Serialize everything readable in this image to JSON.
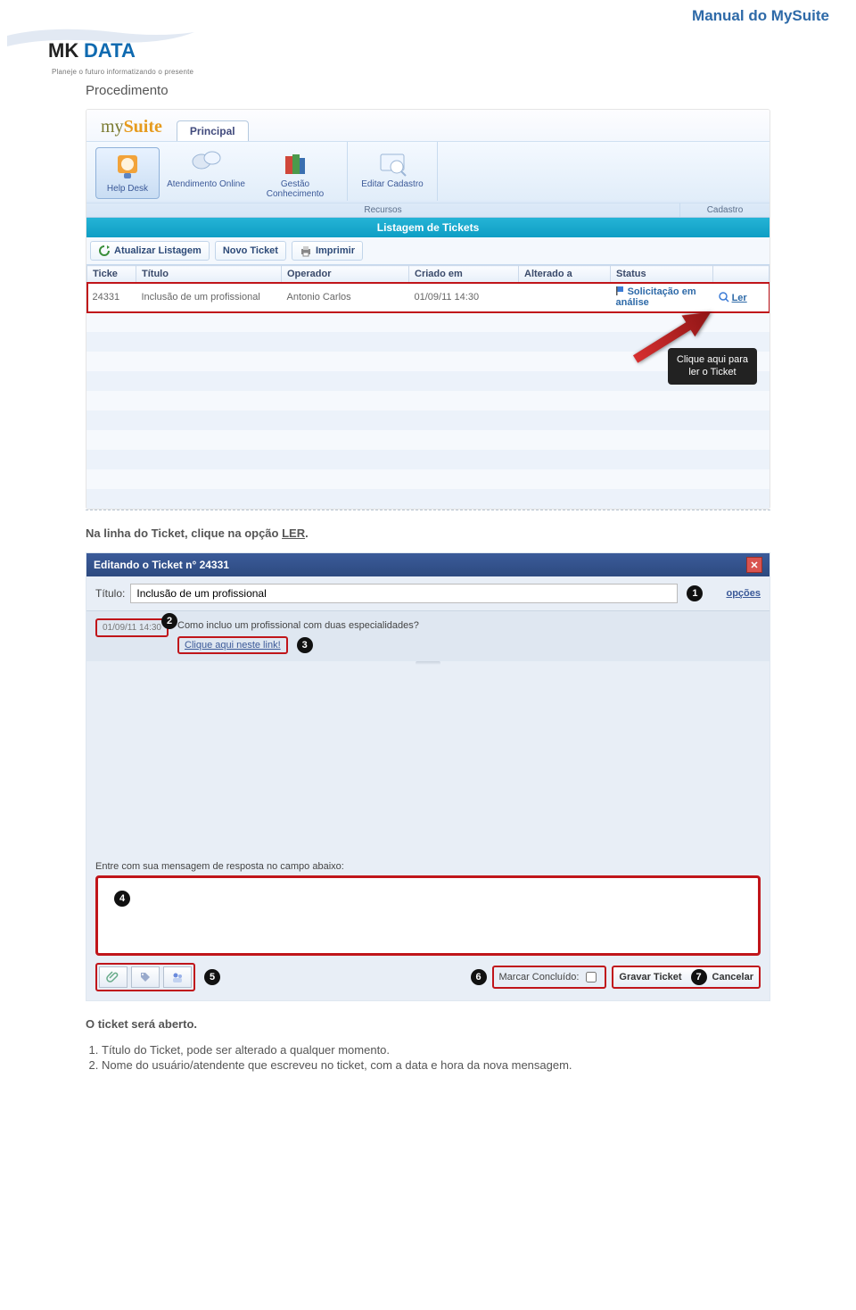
{
  "page": {
    "title": "Manual do MySuite",
    "brand_main": "MK",
    "brand_sub": "DATA",
    "brand_tag": "Planeje o futuro informatizando o presente",
    "section_heading": "Procedimento",
    "caption1_pre": "Na linha do Ticket, clique na opção ",
    "caption1_link": "LER",
    "caption1_post": ".",
    "caption2": "O ticket será aberto.",
    "list": [
      "Título do Ticket, pode ser alterado a qualquer momento.",
      "Nome do usuário/atendente que escreveu no ticket, com a data e hora da nova mensagem."
    ]
  },
  "ss1": {
    "logo_text": "my",
    "logo_bold": "Suite",
    "tab": "Principal",
    "buttons": {
      "help": "Help Desk",
      "atend": "Atendimento Online",
      "gestao": "Gestão Conhecimento",
      "editar": "Editar Cadastro"
    },
    "groups": {
      "recursos": "Recursos",
      "cadastro": "Cadastro"
    },
    "listing_title": "Listagem de Tickets",
    "actions": {
      "refresh": "Atualizar Listagem",
      "new": "Novo Ticket",
      "print": "Imprimir"
    },
    "cols": {
      "ticket": "Ticke",
      "titulo": "Título",
      "operador": "Operador",
      "criado": "Criado em",
      "alterado": "Alterado a",
      "status": "Status"
    },
    "row": {
      "id": "24331",
      "titulo": "Inclusão de um profissional",
      "operador": "Antonio Carlos",
      "criado": "01/09/11 14:30",
      "alterado": "",
      "status": "Solicitação em análise",
      "ler": "Ler"
    },
    "tooltip_l1": "Clique aqui para",
    "tooltip_l2": "ler o Ticket"
  },
  "ss2": {
    "header": "Editando o Ticket n° 24331",
    "titulo_label": "Título:",
    "titulo_value": "Inclusão de um profissional",
    "opcoes": "opções",
    "when": "01/09/11 14:30",
    "question": "Como incluo um profissional com duas especialidades?",
    "link_text": "Clique aqui neste link!",
    "reply_label": "Entre com sua mensagem de resposta no campo abaixo:",
    "marcar": "Marcar Concluído:",
    "gravar": "Gravar Ticket",
    "cancelar": "Cancelar"
  }
}
